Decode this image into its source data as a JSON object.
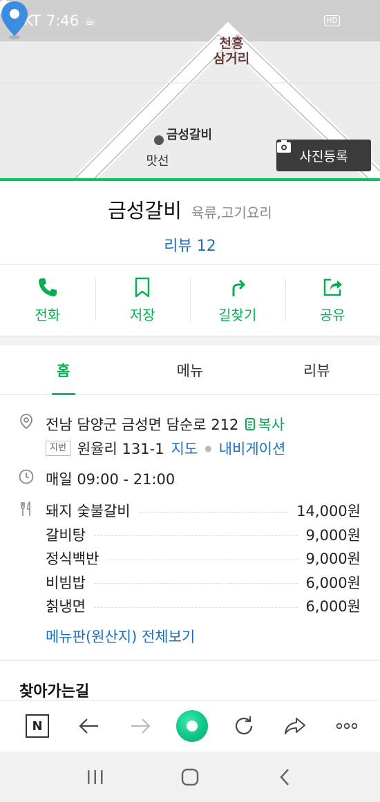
{
  "status_bar": {
    "carrier": "KT",
    "time": "7:46",
    "left_icons": [
      "coffee-icon",
      "notification-icon",
      "notification-icon"
    ],
    "right_icons": [
      "alarm-icon",
      "hd-icon",
      "wifi-icon",
      "signal-icon",
      "battery-icon"
    ],
    "hd_label": "HD"
  },
  "map": {
    "district_label_line1": "천흥",
    "district_label_line2": "삼거리",
    "place_label": "금성갈비",
    "nearby_label": "맛선",
    "photo_button": "사진등록"
  },
  "place": {
    "name": "금성갈비",
    "category": "육류,고기요리",
    "review_label": "리뷰 12"
  },
  "actions": [
    {
      "label": "전화",
      "icon": "phone-icon"
    },
    {
      "label": "저장",
      "icon": "bookmark-icon"
    },
    {
      "label": "길찾기",
      "icon": "directions-icon"
    },
    {
      "label": "공유",
      "icon": "share-icon"
    }
  ],
  "tabs": [
    {
      "label": "홈",
      "active": true
    },
    {
      "label": "메뉴",
      "active": false
    },
    {
      "label": "리뷰",
      "active": false
    }
  ],
  "info": {
    "address": "전남 담양군 금성면 담순로 212",
    "copy_label": "복사",
    "jibun_badge": "지번",
    "jibun_address": "원율리 131-1",
    "map_link": "지도",
    "navigation_link": "내비게이션",
    "hours": "매일 09:00 - 21:00",
    "menu": [
      {
        "name": "돼지 숯불갈비",
        "price": "14,000원"
      },
      {
        "name": "갈비탕",
        "price": "9,000원"
      },
      {
        "name": "정식백반",
        "price": "9,000원"
      },
      {
        "name": "비빔밥",
        "price": "6,000원"
      },
      {
        "name": "칡냉면",
        "price": "6,000원"
      }
    ],
    "menu_more": "메뉴판(원산지) 전체보기"
  },
  "directions_heading": "찾아가는길",
  "toolbar": {
    "home_label": "N"
  },
  "colors": {
    "accent_green": "#03c75a",
    "link_blue": "#1a6fbe",
    "pin_blue": "#3b8de0"
  }
}
